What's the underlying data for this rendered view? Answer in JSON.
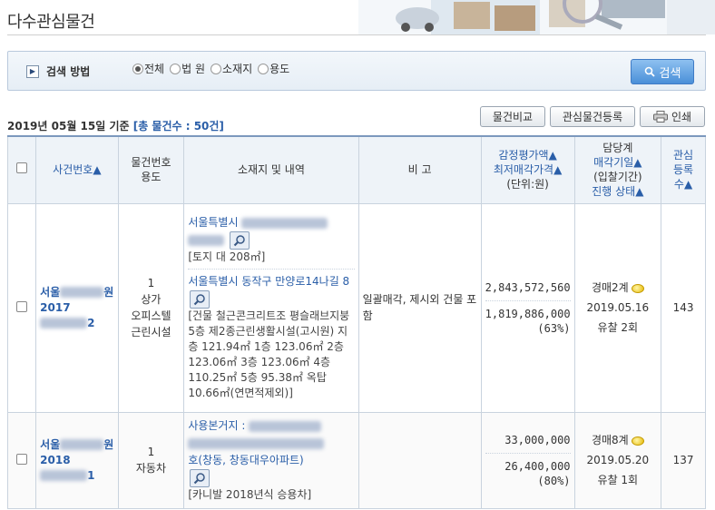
{
  "page": {
    "title": "다수관심물건"
  },
  "search": {
    "label": "검색 방법",
    "options": [
      {
        "label": "전체",
        "selected": true
      },
      {
        "label": "법 원",
        "selected": false
      },
      {
        "label": "소재지",
        "selected": false
      },
      {
        "label": "용도",
        "selected": false
      }
    ],
    "button_label": "검색"
  },
  "summary": {
    "date_text": "2019년 05월 15일 기준",
    "count_text": "[총 물건수 : 50건]"
  },
  "actions": {
    "compare_label": "물건비교",
    "register_label": "관심물건등록",
    "print_label": "인쇄"
  },
  "table": {
    "headers": {
      "case_number": "사건번호▲",
      "item_use_line1": "물건번호",
      "item_use_line2": "용도",
      "location": "소재지 및 내역",
      "remarks": "비 고",
      "price_line1": "감정평가액▲",
      "price_line2": "최저매각가격▲",
      "price_line3": "(단위:원)",
      "dept_line1": "담당계",
      "dept_line2": "매각기일▲",
      "dept_line3": "(입찰기간)",
      "dept_line4": "진행 상태▲",
      "interest_line1": "관심",
      "interest_line2": "등록",
      "interest_line3": "수▲"
    },
    "rows": [
      {
        "case_prefix": "서울",
        "case_suffix": "원",
        "case_year": "2017",
        "case_tail": "2",
        "item_number": "1",
        "use_line1": "상가",
        "use_line2": "오피스텔",
        "use_line3": "근린시설",
        "addr1": "서울특별시",
        "detail1": "[토지 대 208㎡]",
        "addr2": "서울특별시 동작구 만양로14나길 8",
        "detail2": "[건물 철근콘크리트조 평슬래브지붕 5층 제2종근린생활시설(고시원) 지층 121.94㎡ 1층 123.06㎡ 2층 123.06㎡ 3층 123.06㎡ 4층 110.25㎡ 5층 95.38㎡ 옥탑 10.66㎡(연면적제외)]",
        "remarks": "일괄매각, 제시외 건물 포함",
        "appraisal": "2,843,572,560",
        "minimum": "1,819,886,000",
        "ratio": "(63%)",
        "dept": "경매2계",
        "sale_date": "2019.05.16",
        "status": "유찰 2회",
        "interest": "143"
      },
      {
        "case_prefix": "서울",
        "case_suffix": "원",
        "case_year": "2018",
        "case_tail": "1",
        "item_number": "1",
        "use_line1": "자동차",
        "addr1": "사용본거지 :",
        "addr1b": "호(창동, 창동대우아파트)",
        "detail1": "[카니발 2018년식 승용차]",
        "remarks": "",
        "appraisal": "33,000,000",
        "minimum": "26,400,000",
        "ratio": "(80%)",
        "dept": "경매8계",
        "sale_date": "2019.05.20",
        "status": "유찰 1회",
        "interest": "137"
      }
    ]
  }
}
